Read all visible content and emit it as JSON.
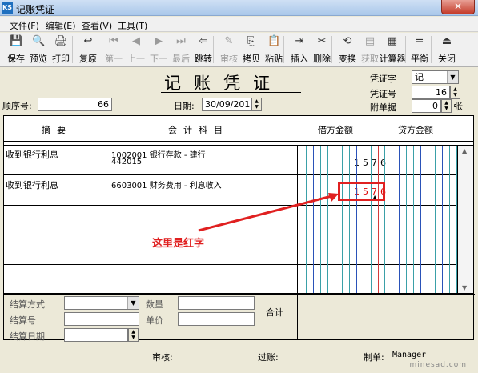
{
  "window": {
    "title": "记账凭证",
    "close_label": "✕",
    "app_icon": "ks-app-icon"
  },
  "menu": [
    "文件(F)",
    "编辑(E)",
    "查看(V)",
    "工具(T)"
  ],
  "toolbar": [
    {
      "label": "保存",
      "icon": "💾",
      "enabled": true
    },
    {
      "label": "预览",
      "icon": "🔍",
      "enabled": true
    },
    {
      "label": "打印",
      "icon": "🖨",
      "enabled": true
    },
    {
      "label": "复原",
      "icon": "↩",
      "enabled": true
    },
    {
      "label": "第一",
      "icon": "⏮",
      "enabled": false
    },
    {
      "label": "上一",
      "icon": "◀",
      "enabled": false
    },
    {
      "label": "下一",
      "icon": "▶",
      "enabled": false
    },
    {
      "label": "最后",
      "icon": "⏭",
      "enabled": false
    },
    {
      "label": "跳转",
      "icon": "⇦",
      "enabled": true
    },
    {
      "label": "审核",
      "icon": "✎",
      "enabled": false
    },
    {
      "label": "拷贝",
      "icon": "⎘",
      "enabled": true
    },
    {
      "label": "粘贴",
      "icon": "📋",
      "enabled": true
    },
    {
      "label": "插入",
      "icon": "⇥",
      "enabled": true
    },
    {
      "label": "删除",
      "icon": "✂",
      "enabled": true
    },
    {
      "label": "变换",
      "icon": "⟲",
      "enabled": true
    },
    {
      "label": "获取",
      "icon": "▤",
      "enabled": false
    },
    {
      "label": "计算器",
      "icon": "▦",
      "enabled": true
    },
    {
      "label": "平衡",
      "icon": "=",
      "enabled": true
    },
    {
      "label": "关闭",
      "icon": "⏏",
      "enabled": true
    }
  ],
  "header": {
    "title": "记账凭证",
    "seq_label": "顺序号:",
    "seq_value": "66",
    "date_label": "日期:",
    "date_value": "30/09/2013",
    "voucher_type_label": "凭证字",
    "voucher_type_value": "记",
    "voucher_no_label": "凭证号",
    "voucher_no_value": "16",
    "attach_label": "附单据",
    "attach_value": "0",
    "attach_unit": "张"
  },
  "grid": {
    "headers": {
      "summary": "摘要",
      "account": "会计科目",
      "debit": "借方金额",
      "credit": "贷方金额"
    },
    "rows": [
      {
        "summary": "收到银行利息",
        "account_line1": "1002001 银行存款 - 建行",
        "account_line2": "442015",
        "debit": "1576",
        "credit": ""
      },
      {
        "summary": "收到银行利息",
        "account_line1": "6603001 财务费用 - 利息收入",
        "account_line2": "",
        "debit": "1576",
        "credit": ""
      }
    ]
  },
  "annotation": {
    "text": "这里是红字",
    "color": "#e02020"
  },
  "bottom": {
    "settle_method_label": "结算方式",
    "settle_no_label": "结算号",
    "settle_date_label": "结算日期",
    "qty_label": "数量",
    "price_label": "单价",
    "total_label": "合计"
  },
  "footer": {
    "audit_label": "审核:",
    "post_label": "过账:",
    "maker_label": "制单:",
    "maker_value": "Manager"
  },
  "watermark": "minesad.com"
}
